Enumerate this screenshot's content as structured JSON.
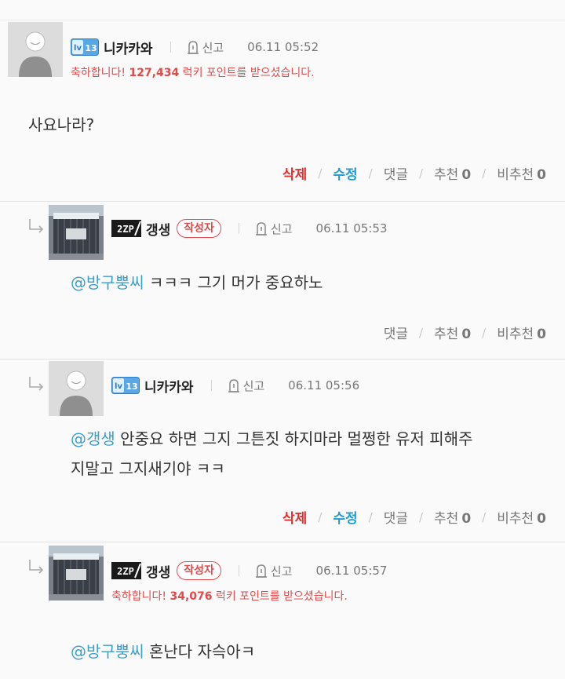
{
  "comments": [
    {
      "nick": "니카카와",
      "level_badge": "lv 13",
      "report_label": "신고",
      "time": "06.11 05:52",
      "congrats": {
        "prefix": "축하합니다! ",
        "points": "127,434",
        "suffix": " 럭키 포인트를 받으셨습니다."
      },
      "text": "사요나라?",
      "actions": {
        "delete": "삭제",
        "edit": "수정",
        "reply": "댓글",
        "like": "추천",
        "like_count": "0",
        "dislike": "비추천",
        "dislike_count": "0"
      }
    },
    {
      "nick": "갱생",
      "number_badge": "2ZP",
      "author_badge": "작성자",
      "report_label": "신고",
      "time": "06.11 05:53",
      "mention": "@방구뿡씨",
      "text": " ㅋㅋㅋ 그기 머가 중요하노",
      "actions": {
        "reply": "댓글",
        "like": "추천",
        "like_count": "0",
        "dislike": "비추천",
        "dislike_count": "0"
      }
    },
    {
      "nick": "니카카와",
      "level_badge": "lv 13",
      "report_label": "신고",
      "time": "06.11 05:56",
      "mention": "@갱생",
      "text_line1": " 안중요 하면 그지 그튼짓 하지마라 멀쩡한 유저 피해주",
      "text_line2": "지말고 그지새기야 ㅋㅋ",
      "actions": {
        "delete": "삭제",
        "edit": "수정",
        "reply": "댓글",
        "like": "추천",
        "like_count": "0",
        "dislike": "비추천",
        "dislike_count": "0"
      }
    },
    {
      "nick": "갱생",
      "number_badge": "2ZP",
      "author_badge": "작성자",
      "report_label": "신고",
      "time": "06.11 05:57",
      "congrats": {
        "prefix": "축하합니다! ",
        "points": "34,076",
        "suffix": " 럭키 포인트를 받으셨습니다."
      },
      "mention": "@방구뿡씨",
      "text": " 혼난다 자슥아ㅋ"
    }
  ],
  "colors": {
    "accent_red": "#e24a4a",
    "mention_blue": "#3aa0c8",
    "edit_blue": "#1e9ad6",
    "delete_red": "#e03030"
  }
}
